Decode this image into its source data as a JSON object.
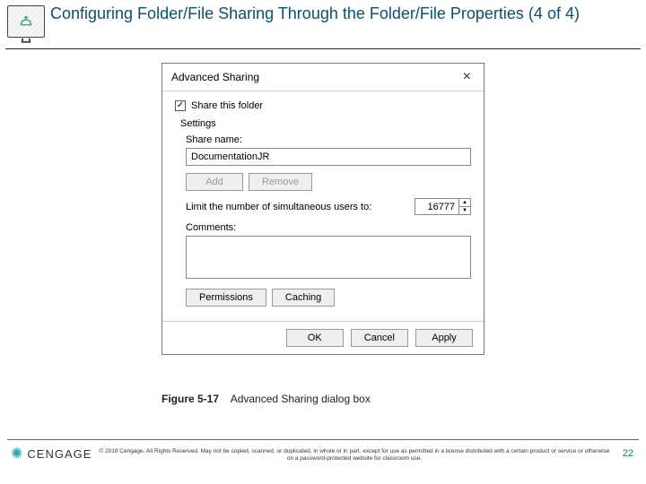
{
  "slide": {
    "title": "Configuring Folder/File Sharing Through the Folder/File Properties (4 of 4)"
  },
  "dialog": {
    "title": "Advanced Sharing",
    "share_checkbox_label": "Share this folder",
    "share_checked_glyph": "✓",
    "settings_label": "Settings",
    "share_name_label": "Share name:",
    "share_name_value": "DocumentationJR",
    "add_label": "Add",
    "remove_label": "Remove",
    "limit_label": "Limit the number of simultaneous users to:",
    "limit_value": "16777",
    "comments_label": "Comments:",
    "comments_value": "",
    "permissions_label": "Permissions",
    "caching_label": "Caching",
    "ok_label": "OK",
    "cancel_label": "Cancel",
    "apply_label": "Apply"
  },
  "figure": {
    "number": "Figure 5-17",
    "caption": "Advanced Sharing dialog box"
  },
  "footer": {
    "brand": "CENGAGE",
    "copyright": "© 2018 Cengage. All Rights Reserved. May not be copied, scanned, or duplicated, in whole or in part, except for use as permitted in a license distributed with a certain product or service or otherwise on a password-protected website for classroom use.",
    "page": "22"
  }
}
